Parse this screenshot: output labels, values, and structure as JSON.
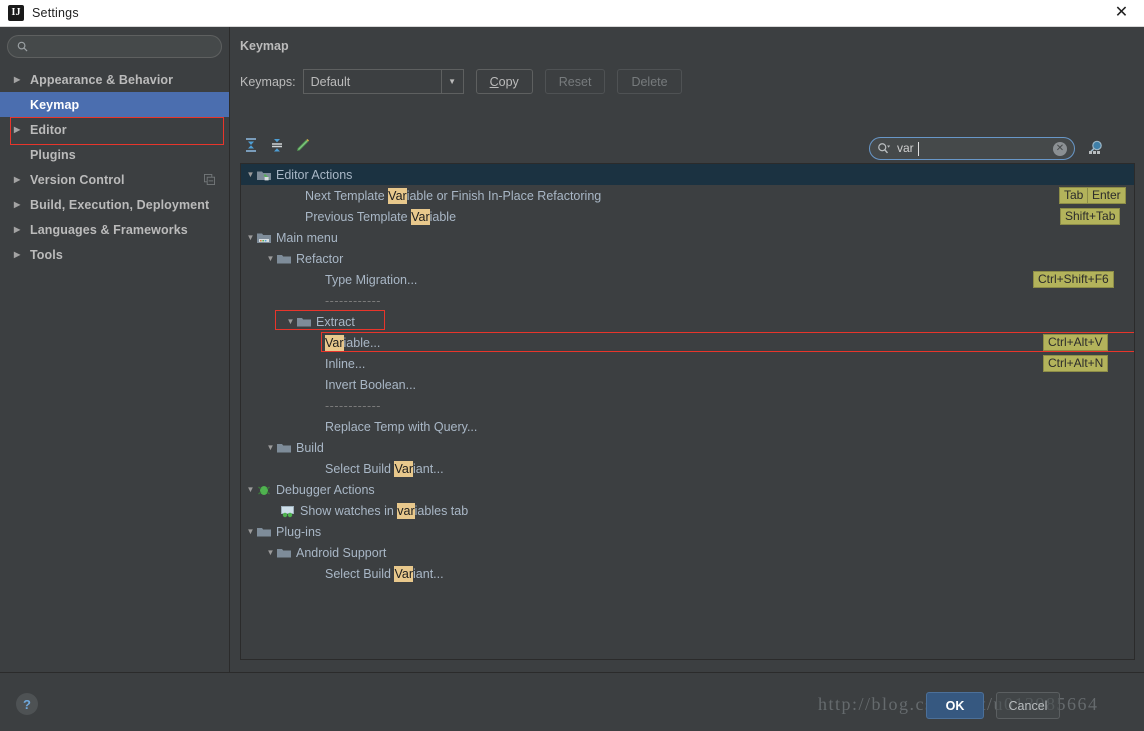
{
  "window": {
    "title": "Settings",
    "logo_text": "IJ",
    "close_icon": "✕"
  },
  "sidebar": {
    "search_placeholder": "",
    "search_value": "",
    "search_icon": "search-icon",
    "items": [
      {
        "label": "Appearance & Behavior",
        "expandable": true,
        "selected": false,
        "trailing_icon": ""
      },
      {
        "label": "Keymap",
        "expandable": false,
        "selected": true,
        "trailing_icon": ""
      },
      {
        "label": "Editor",
        "expandable": true,
        "selected": false,
        "trailing_icon": ""
      },
      {
        "label": "Plugins",
        "expandable": false,
        "selected": false,
        "trailing_icon": ""
      },
      {
        "label": "Version Control",
        "expandable": true,
        "selected": false,
        "trailing_icon": "copy-icon"
      },
      {
        "label": "Build, Execution, Deployment",
        "expandable": true,
        "selected": false,
        "trailing_icon": ""
      },
      {
        "label": "Languages & Frameworks",
        "expandable": true,
        "selected": false,
        "trailing_icon": ""
      },
      {
        "label": "Tools",
        "expandable": true,
        "selected": false,
        "trailing_icon": ""
      }
    ]
  },
  "main": {
    "panel_title": "Keymap",
    "keymaps_label": "Keymaps:",
    "keymap_selected": "Default",
    "keymap_options": [
      "Default"
    ],
    "buttons": {
      "copy": "Copy",
      "copy_mnemonic": "C",
      "reset": "Reset",
      "delete": "Delete"
    },
    "toolbar_icons": [
      "collapse-all-icon",
      "expand-all-icon",
      "edit-shortcut-icon"
    ],
    "tree_search": {
      "value": "var",
      "placeholder": "",
      "search_icon": "search-dropdown-icon",
      "clear_icon": "✕"
    },
    "find_by_shortcut_icon": "find-by-shortcut-icon"
  },
  "tree": {
    "rows": [
      {
        "type": "node",
        "indent": 0,
        "tri": "▼",
        "icon": "editor-actions-icon",
        "text_before": "Editor Actions",
        "highlight": "",
        "text_after": "",
        "selected": true,
        "shortcuts": []
      },
      {
        "type": "leaf",
        "indent": 3,
        "tri": "",
        "icon": "",
        "text_before": "Next Template ",
        "highlight": "Var",
        "text_after": "iable or Finish In-Place Refactoring",
        "selected": false,
        "shortcuts": [
          "Tab",
          "Enter"
        ]
      },
      {
        "type": "leaf",
        "indent": 3,
        "tri": "",
        "icon": "",
        "text_before": "Previous Template ",
        "highlight": "Var",
        "text_after": "iable",
        "selected": false,
        "shortcuts": [
          "Shift+Tab"
        ]
      },
      {
        "type": "node",
        "indent": 0,
        "tri": "▼",
        "icon": "main-menu-icon",
        "text_before": "Main menu",
        "highlight": "",
        "text_after": "",
        "selected": false,
        "shortcuts": []
      },
      {
        "type": "node",
        "indent": 1,
        "tri": "▼",
        "icon": "folder-icon",
        "text_before": "Refactor",
        "highlight": "",
        "text_after": "",
        "selected": false,
        "shortcuts": []
      },
      {
        "type": "leaf",
        "indent": 3,
        "tri": "",
        "icon": "",
        "text_before": "Type Migration...",
        "highlight": "",
        "text_after": "",
        "selected": false,
        "shortcuts": [
          "Ctrl+Shift+F6"
        ]
      },
      {
        "type": "separator",
        "indent": 3,
        "text": "------------"
      },
      {
        "type": "node",
        "indent": 2,
        "tri": "▼",
        "icon": "folder-icon",
        "text_before": "Extract",
        "highlight": "",
        "text_after": "",
        "selected": false,
        "shortcuts": []
      },
      {
        "type": "leaf",
        "indent": 4,
        "tri": "",
        "icon": "",
        "text_before": "",
        "highlight": "Var",
        "text_after": "iable...",
        "selected": false,
        "shortcuts": [
          "Ctrl+Alt+V"
        ]
      },
      {
        "type": "leaf",
        "indent": 3,
        "tri": "",
        "icon": "",
        "text_before": "Inline...",
        "highlight": "",
        "text_after": "",
        "selected": false,
        "shortcuts": [
          "Ctrl+Alt+N"
        ]
      },
      {
        "type": "leaf",
        "indent": 3,
        "tri": "",
        "icon": "",
        "text_before": "Invert Boolean...",
        "highlight": "",
        "text_after": "",
        "selected": false,
        "shortcuts": []
      },
      {
        "type": "separator",
        "indent": 3,
        "text": "------------"
      },
      {
        "type": "leaf",
        "indent": 3,
        "tri": "",
        "icon": "",
        "text_before": "Replace Temp with Query...",
        "highlight": "",
        "text_after": "",
        "selected": false,
        "shortcuts": []
      },
      {
        "type": "node",
        "indent": 1,
        "tri": "▼",
        "icon": "folder-icon",
        "text_before": "Build",
        "highlight": "",
        "text_after": "",
        "selected": false,
        "shortcuts": []
      },
      {
        "type": "leaf",
        "indent": 3,
        "tri": "",
        "icon": "",
        "text_before": "Select Build ",
        "highlight": "Var",
        "text_after": "iant...",
        "selected": false,
        "shortcuts": []
      },
      {
        "type": "node",
        "indent": 0,
        "tri": "▼",
        "icon": "debugger-icon",
        "text_before": "Debugger Actions",
        "highlight": "",
        "text_after": "",
        "selected": false,
        "shortcuts": []
      },
      {
        "type": "leaf",
        "indent": 1,
        "tri": "",
        "icon": "watches-icon",
        "text_before": "Show watches in ",
        "highlight": "var",
        "text_after": "iables tab",
        "selected": false,
        "shortcuts": []
      },
      {
        "type": "node",
        "indent": 0,
        "tri": "▼",
        "icon": "folder-icon",
        "text_before": "Plug-ins",
        "highlight": "",
        "text_after": "",
        "selected": false,
        "shortcuts": []
      },
      {
        "type": "node",
        "indent": 1,
        "tri": "▼",
        "icon": "folder-icon",
        "text_before": "Android Support",
        "highlight": "",
        "text_after": "",
        "selected": false,
        "shortcuts": []
      },
      {
        "type": "leaf",
        "indent": 3,
        "tri": "",
        "icon": "",
        "text_before": "Select Build ",
        "highlight": "Var",
        "text_after": "iant...",
        "selected": false,
        "shortcuts": []
      }
    ]
  },
  "footer": {
    "help_label": "?",
    "ok_label": "OK",
    "cancel_label": "Cancel",
    "watermark": "http://blog.csdn.net/u013985664"
  },
  "colors": {
    "accent_selection": "#4b6eaf",
    "tree_selection": "#1b3241",
    "highlight_match": "#e8c88c",
    "shortcut_badge": "#b3b35b",
    "annotation_red": "#e8352b",
    "ok_button": "#365880",
    "panel_bg": "#3c3f41",
    "text": "#a9b7c6"
  }
}
